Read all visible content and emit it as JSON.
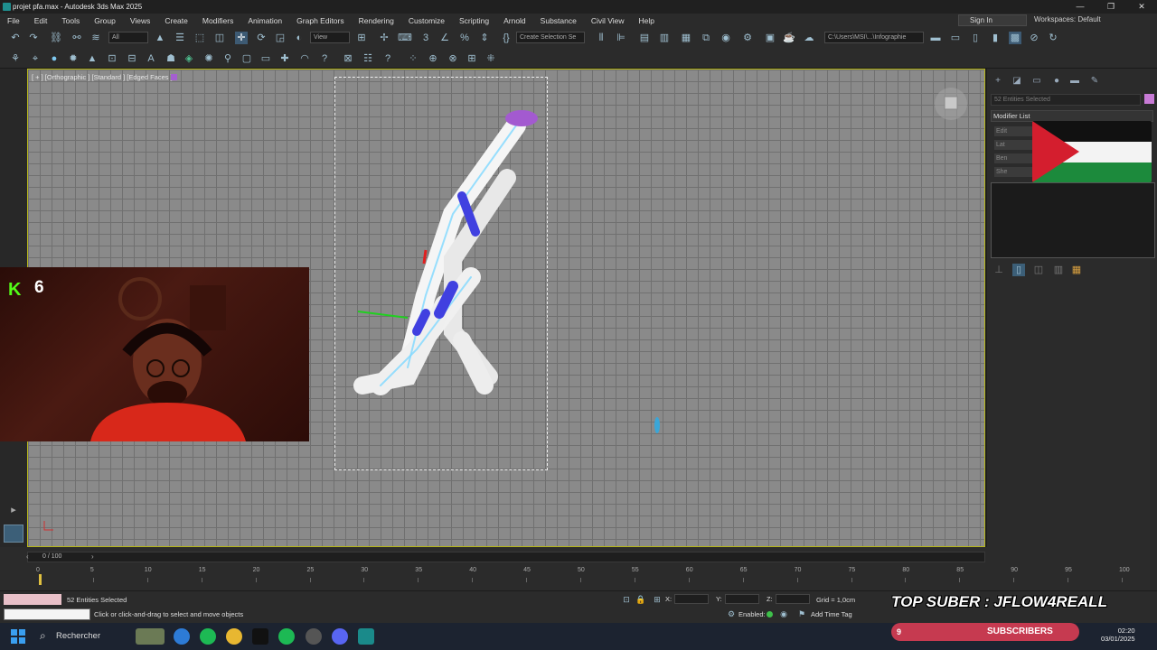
{
  "window": {
    "title": "projet pfa.max - Autodesk 3ds Max 2025",
    "controls": [
      "—",
      "❐",
      "✕"
    ]
  },
  "menu": {
    "items": [
      "File",
      "Edit",
      "Tools",
      "Group",
      "Views",
      "Create",
      "Modifiers",
      "Animation",
      "Graph Editors",
      "Rendering",
      "Customize",
      "Scripting",
      "Arnold",
      "Substance",
      "Civil View",
      "Help"
    ],
    "sign_in": "Sign In",
    "workspaces_label": "Workspaces:",
    "workspace_value": "Default"
  },
  "toolbar": {
    "filter_dropdown": "All",
    "reference_dropdown": "View",
    "selection_set": "Create Selection Se",
    "project_path": "C:\\Users\\MSI\\...\\Infographie"
  },
  "viewport": {
    "label": "[ + ] [Orthographic ] [Standard ] [Edged Faces ]"
  },
  "command_panel": {
    "name_field": "52 Entities Selected",
    "modifier_list": "Modifier List",
    "stack_buttons": [
      "Edit",
      "Lat",
      "Ben",
      "She"
    ],
    "swatch_color": "#c87bd6"
  },
  "timeline": {
    "frame_label": "0 / 100",
    "ticks": [
      "0",
      "5",
      "10",
      "15",
      "20",
      "25",
      "30",
      "35",
      "40",
      "45",
      "50",
      "55",
      "60",
      "65",
      "70",
      "75",
      "80",
      "85",
      "90",
      "95",
      "100"
    ]
  },
  "status": {
    "selection_count": "52 Entities Selected",
    "prompt": "Click or click-and-drag to select and move objects",
    "x_label": "X:",
    "y_label": "Y:",
    "z_label": "Z:",
    "grid": "Grid = 1,0cm",
    "enabled": "Enabled:",
    "add_time_tag": "Add Time Tag"
  },
  "overlay": {
    "top_suber": "TOP SUBER : JFLOW4REALL",
    "subscribers_label": "SUBSCRIBERS",
    "subscribers_count": "9",
    "viewers": "6",
    "kick_logo": "K"
  },
  "taskbar": {
    "search": "Rechercher",
    "time": "02:20",
    "date": "03/01/2025"
  }
}
